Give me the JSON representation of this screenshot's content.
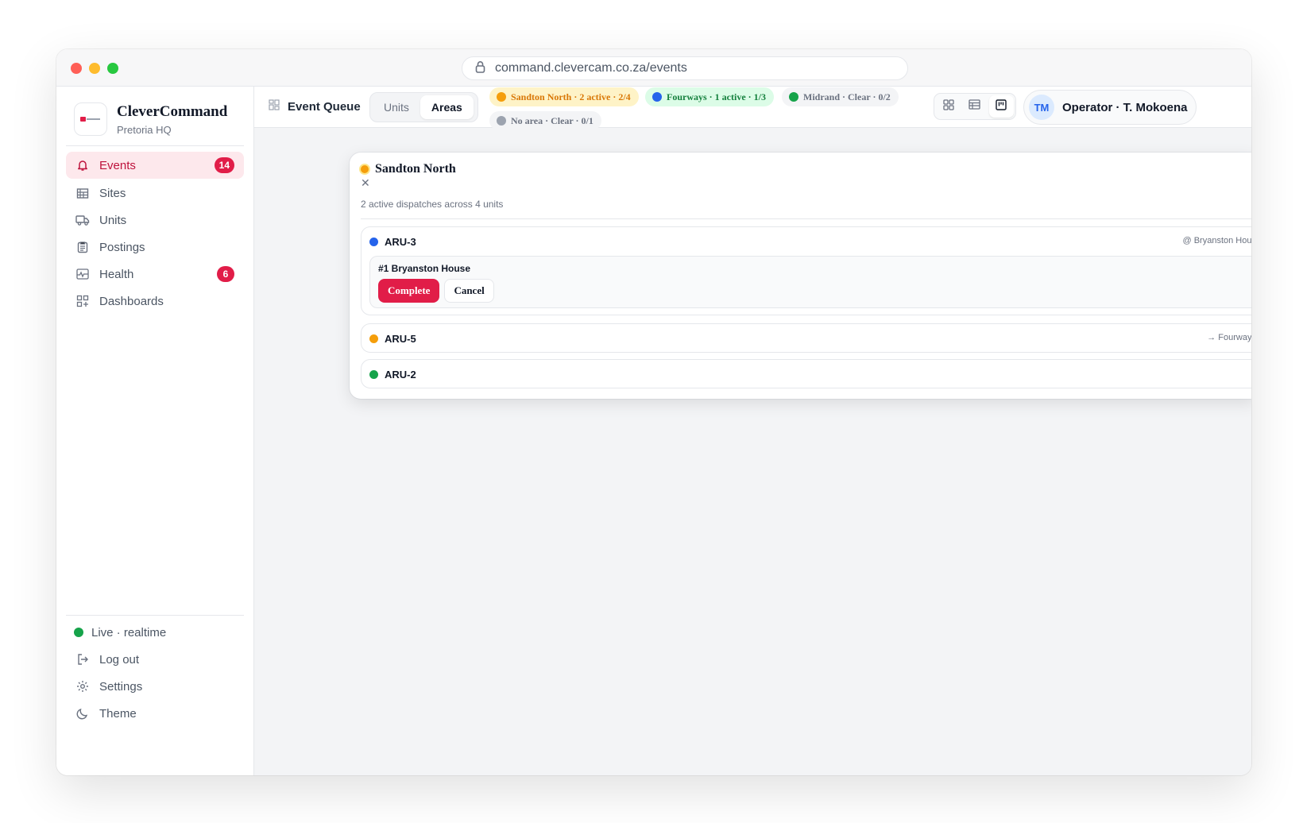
{
  "browser": {
    "url": "command.clevercam.co.za/events"
  },
  "brand": {
    "name": "CleverCommand",
    "subtitle": "Pretoria HQ"
  },
  "sidebar": {
    "items": [
      {
        "label": "Events",
        "icon": "bell-icon",
        "badge": "14",
        "active": true
      },
      {
        "label": "Sites",
        "icon": "building-icon"
      },
      {
        "label": "Units",
        "icon": "truck-icon"
      },
      {
        "label": "Postings",
        "icon": "clipboard-icon"
      },
      {
        "label": "Health",
        "icon": "activity-icon",
        "badge": "6"
      },
      {
        "label": "Dashboards",
        "icon": "dashboard-icon"
      }
    ],
    "bottom": {
      "live_label": "Live · realtime",
      "logout_label": "Log out",
      "settings_label": "Settings",
      "theme_label": "Theme"
    }
  },
  "topbar": {
    "title": "Event Queue",
    "tabs": [
      "Units",
      "Areas"
    ],
    "active_tab": "Areas",
    "chips": [
      {
        "label": "Sandton North · 2 active · 2/4",
        "color": "#f59e0b",
        "text_color": "#d97706",
        "bg": "#fef3c7"
      },
      {
        "label": "Fourways · 1 active · 1/3",
        "color": "#2563eb",
        "text_color": "#15803d",
        "bg": "#dcfce7"
      },
      {
        "label": "Midrand · Clear · 0/2",
        "color": "#16a34a",
        "text_color": "#6b7280",
        "bg": "#f3f4f6"
      },
      {
        "label": "No area · Clear · 0/1",
        "color": "#9ca3af",
        "text_color": "#6b7280",
        "bg": "#f3f4f6"
      }
    ],
    "operator": {
      "initials": "TM",
      "name": "Operator · T. Mokoena"
    }
  },
  "panel": {
    "title": "Sandton North",
    "subtitle": "2 active dispatches across 4 units",
    "units": [
      {
        "name": "ARU-3",
        "status_color": "#2563eb",
        "location": "@ Bryanston Hous",
        "dispatch": {
          "title": "#1 Bryanston House",
          "complete_label": "Complete",
          "cancel_label": "Cancel"
        }
      },
      {
        "name": "ARU-5",
        "status_color": "#f59e0b",
        "location": "→ Fourways "
      },
      {
        "name": "ARU-2",
        "status_color": "#16a34a",
        "location": ""
      }
    ]
  },
  "colors": {
    "accent": "#e11d48",
    "accent_soft": "#fde8ec"
  }
}
